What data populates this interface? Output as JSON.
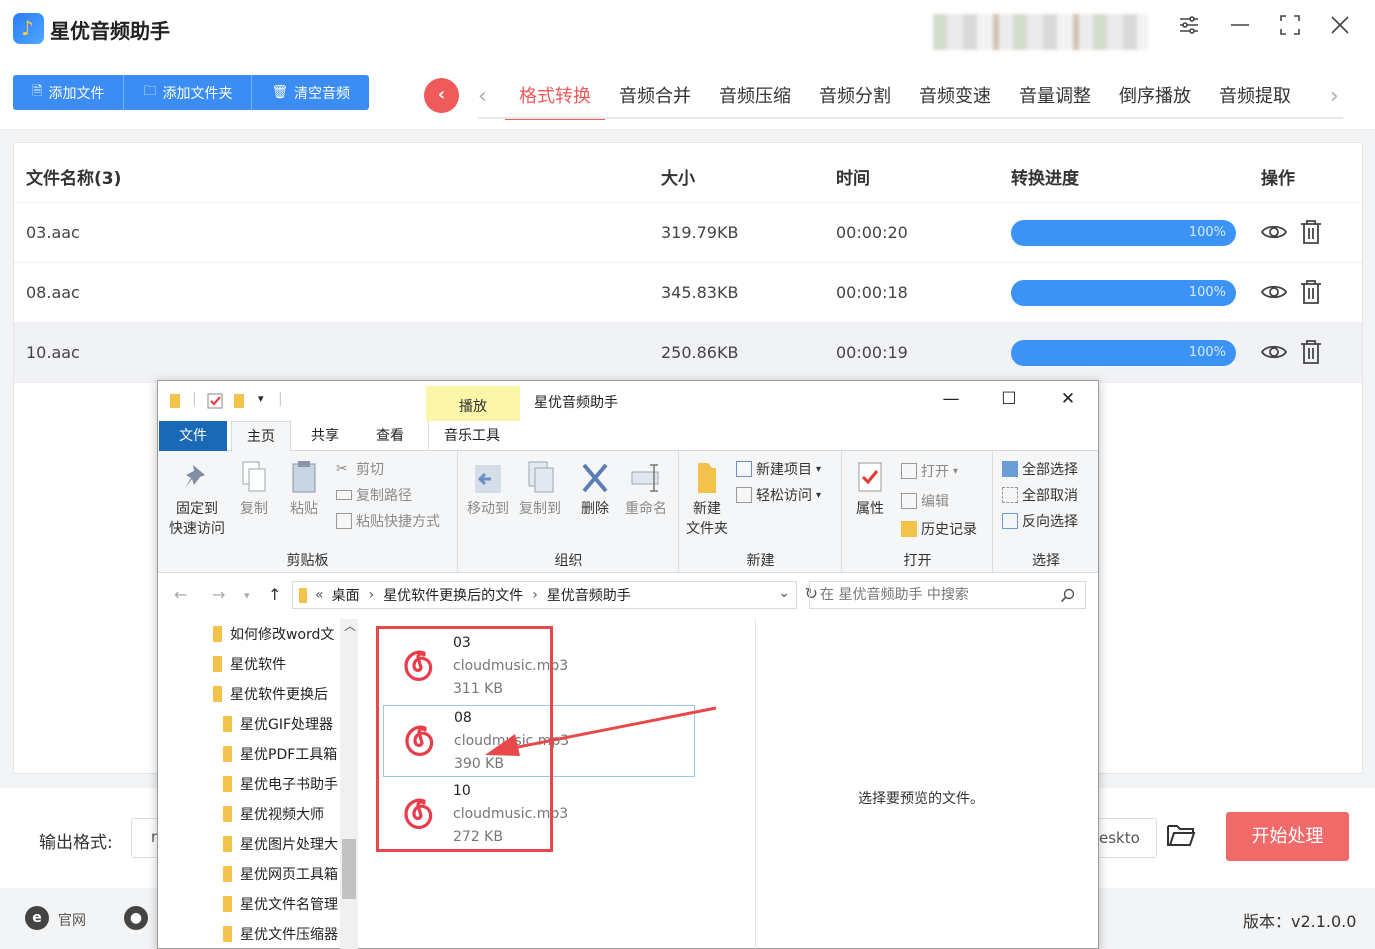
{
  "app": {
    "title": "星优音频助手"
  },
  "toolbar": {
    "add_file": "添加文件",
    "add_folder": "添加文件夹",
    "clear": "清空音频",
    "tabs": [
      "格式转换",
      "音频合并",
      "音频压缩",
      "音频分割",
      "音频变速",
      "音量调整",
      "倒序播放",
      "音频提取"
    ],
    "active_tab": 0
  },
  "table": {
    "headers": {
      "name": "文件名称(3)",
      "size": "大小",
      "time": "时间",
      "progress": "转换进度",
      "action": "操作"
    },
    "rows": [
      {
        "name": "03.aac",
        "size": "319.79KB",
        "time": "00:00:20",
        "progress": "100%",
        "progress_value": 100
      },
      {
        "name": "08.aac",
        "size": "345.83KB",
        "time": "00:00:18",
        "progress": "100%",
        "progress_value": 100
      },
      {
        "name": "10.aac",
        "size": "250.86KB",
        "time": "00:00:19",
        "progress": "100%",
        "progress_value": 100
      }
    ],
    "selected_row": 2
  },
  "bottom": {
    "output_label": "输出格式:",
    "output_format_partial": "m",
    "output_path_partial": "eskto",
    "start_button": "开始处理"
  },
  "footer": {
    "website": "官网",
    "version": "版本：v2.1.0.0"
  },
  "explorer": {
    "context_tab": "播放",
    "title": "星优音频助手",
    "tabs": {
      "file": "文件",
      "home": "主页",
      "share": "共享",
      "view": "查看",
      "music_tools": "音乐工具"
    },
    "clipboard": {
      "pin": [
        "固定到",
        "快速访问"
      ],
      "copy": "复制",
      "paste": "粘贴",
      "cut": "剪切",
      "copy_path": "复制路径",
      "paste_shortcut": "粘贴快捷方式",
      "label": "剪贴板"
    },
    "organize": {
      "move_to": "移动到",
      "copy_to": "复制到",
      "delete": "删除",
      "rename": "重命名",
      "label": "组织"
    },
    "new": {
      "new_folder": [
        "新建",
        "文件夹"
      ],
      "new_item": "新建项目",
      "easy_access": "轻松访问",
      "label": "新建"
    },
    "open": {
      "properties": "属性",
      "open": "打开",
      "edit": "编辑",
      "history": "历史记录",
      "label": "打开"
    },
    "select": {
      "select_all": "全部选择",
      "select_none": "全部取消",
      "invert": "反向选择",
      "label": "选择"
    },
    "address": {
      "prefix": "«",
      "crumbs": [
        "桌面",
        "星优软件更换后的文件",
        "星优音频助手"
      ]
    },
    "search_placeholder": "在 星优音频助手 中搜索",
    "tree": [
      "如何修改word文",
      "星优软件",
      "星优软件更换后",
      "星优GIF处理器",
      "星优PDF工具箱",
      "星优电子书助手",
      "星优视频大师",
      "星优图片处理大",
      "星优网页工具箱",
      "星优文件名管理",
      "星优文件压缩器"
    ],
    "files": [
      {
        "name": "03",
        "type": "cloudmusic.mp3",
        "size": "311 KB"
      },
      {
        "name": "08",
        "type": "cloudmusic.mp3",
        "size": "390 KB"
      },
      {
        "name": "10",
        "type": "cloudmusic.mp3",
        "size": "272 KB"
      }
    ],
    "selected_file": 1,
    "preview_text": "选择要预览的文件。"
  },
  "colors": {
    "accent_blue": "#3b8df3",
    "accent_red": "#ef5a5a",
    "annotation_red": "#e8484a",
    "explorer_blue": "#1a69b4"
  }
}
